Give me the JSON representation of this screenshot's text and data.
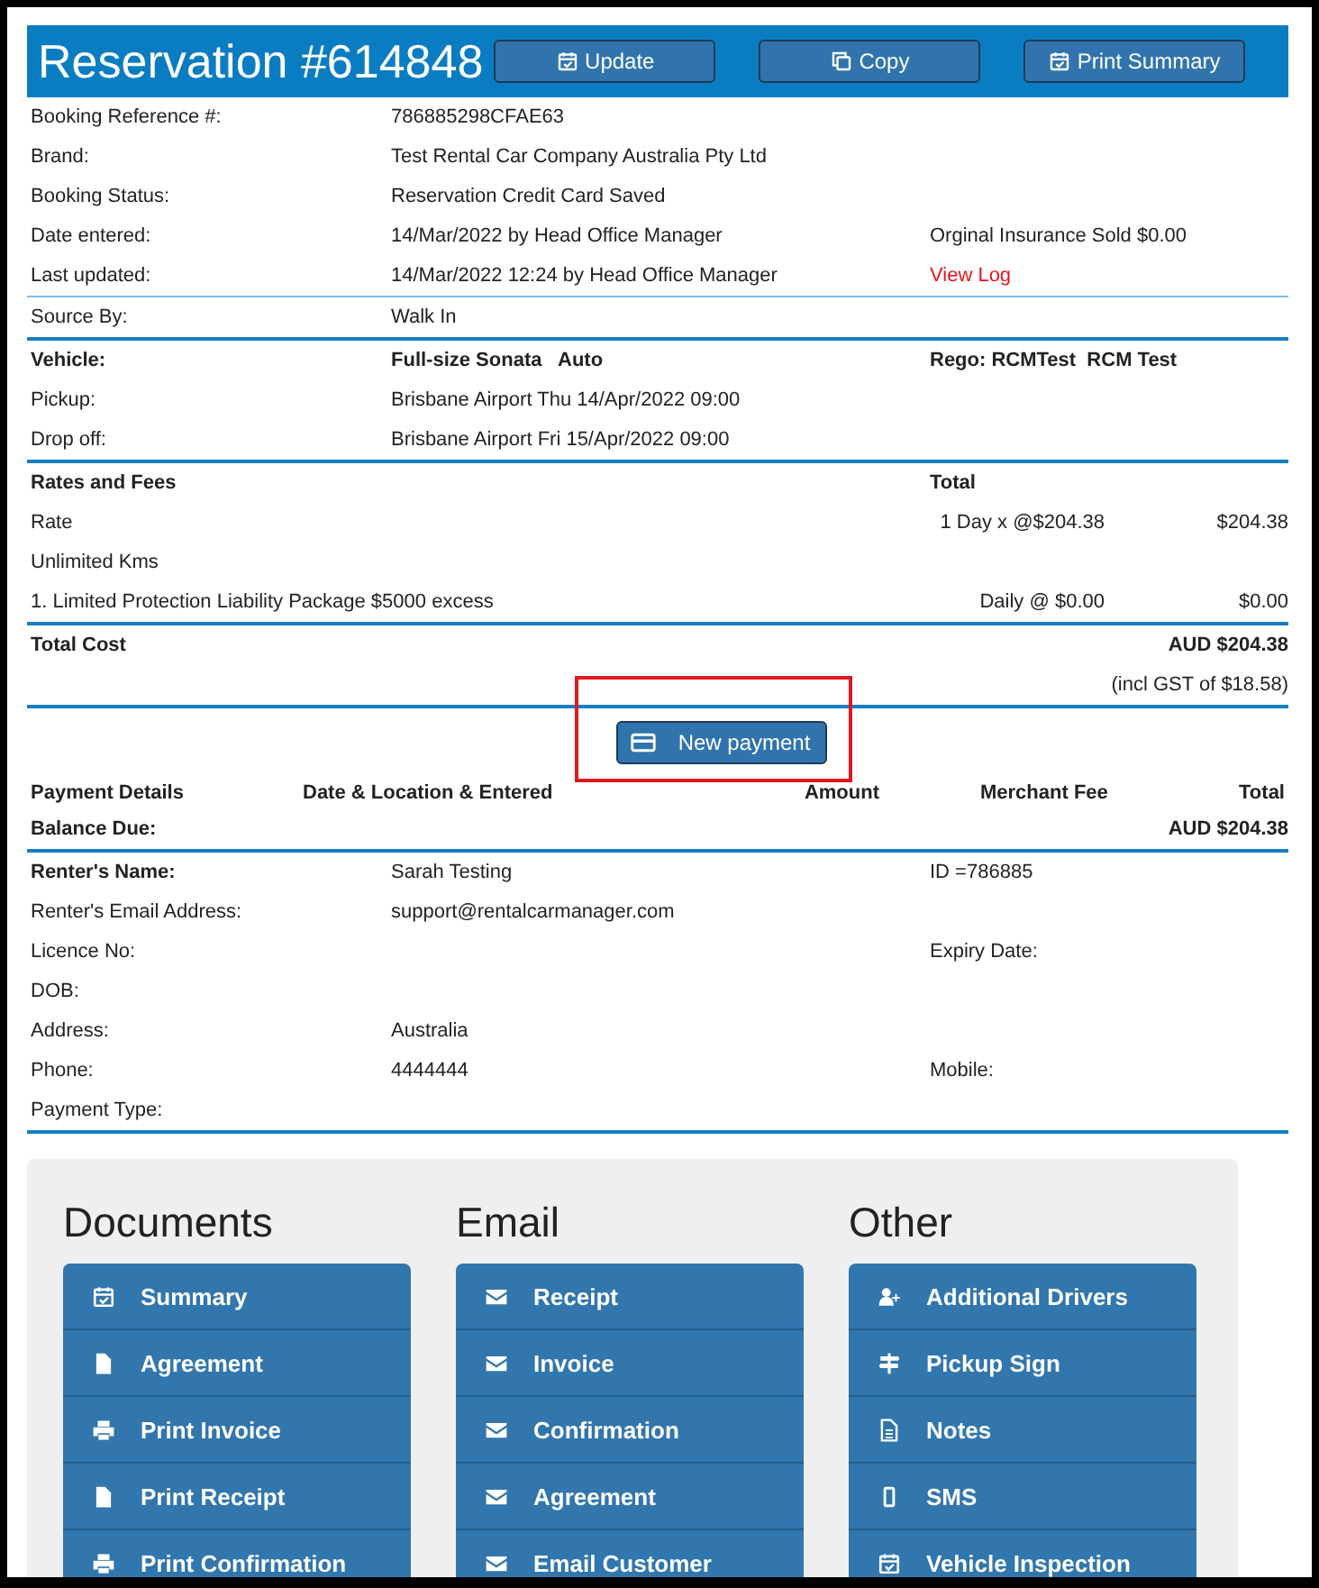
{
  "header": {
    "title": "Reservation #614848",
    "buttons": [
      {
        "label": "Update",
        "kind": "calendar"
      },
      {
        "label": "Copy",
        "kind": "copy"
      },
      {
        "label": "Print Summary",
        "kind": "calendar"
      }
    ]
  },
  "sections": [
    {
      "rows": [
        {
          "kind": "field",
          "label": "Booking Reference #:",
          "value": "786885298CFAE63"
        },
        {
          "kind": "field",
          "label": "Brand:",
          "value": "Test Rental Car Company Australia Pty Ltd"
        },
        {
          "kind": "field",
          "label": "Booking Status:",
          "value": "Reservation Credit Card Saved"
        },
        {
          "kind": "field",
          "label": "Date entered:",
          "value": "14/Mar/2022 by Head Office Manager",
          "side": "Orginal Insurance Sold $0.00"
        },
        {
          "kind": "field",
          "label": "Last updated:",
          "value": "14/Mar/2022 12:24 by Head Office Manager",
          "link": "View Log"
        }
      ]
    },
    {
      "rows": [
        {
          "kind": "field",
          "label": "Source By:",
          "value": "Walk In"
        }
      ]
    },
    {
      "rows": [
        {
          "kind": "field",
          "label": "Vehicle:",
          "value": "Full-size Sonata   Auto",
          "side": "Rego: RCMTest  RCM Test",
          "bold": true
        },
        {
          "kind": "field",
          "label": "Pickup:",
          "value": "Brisbane Airport Thu 14/Apr/2022 09:00"
        },
        {
          "kind": "field",
          "label": "Drop off:",
          "value": "Brisbane Airport Fri 15/Apr/2022 09:00"
        }
      ]
    },
    {
      "rows": [
        {
          "kind": "field",
          "label": "Rates and Fees",
          "side": "Total",
          "bold": true
        },
        {
          "kind": "fee",
          "label": "Rate",
          "rate": "1 Day x @$204.38",
          "amount": "$204.38"
        },
        {
          "kind": "fee",
          "label": "Unlimited Kms"
        },
        {
          "kind": "fee",
          "label": "1. Limited Protection Liability Package $5000 excess",
          "rate": "Daily @ $0.00",
          "amount": "$0.00"
        }
      ]
    },
    {
      "rows": [
        {
          "kind": "total",
          "label": "Total Cost",
          "amount": "AUD $204.38",
          "bold": true
        },
        {
          "kind": "total",
          "amount": "(incl GST of $18.58)"
        }
      ]
    },
    {
      "rows": [
        {
          "kind": "button",
          "label": "New payment",
          "highlighted": true
        },
        {
          "kind": "columns",
          "columns": [
            "Payment Details",
            "Date & Location & Entered",
            "Amount",
            "Merchant Fee",
            "Total"
          ]
        },
        {
          "kind": "total",
          "label": "Balance Due:",
          "amount": "AUD $204.38",
          "bold": true
        }
      ]
    },
    {
      "rows": [
        {
          "kind": "field",
          "label": "Renter's Name:",
          "value": "Sarah Testing",
          "side": "ID =786885",
          "label_bold": true
        },
        {
          "kind": "field",
          "label": "Renter's Email Address:",
          "value": "support@rentalcarmanager.com"
        },
        {
          "kind": "field",
          "label": "Licence No:",
          "side": "Expiry Date:"
        },
        {
          "kind": "field",
          "label": "DOB:"
        },
        {
          "kind": "field",
          "label": "Address:",
          "value": "Australia"
        },
        {
          "kind": "field",
          "label": "Phone:",
          "value": "4444444",
          "side": "Mobile:"
        },
        {
          "kind": "field",
          "label": "Payment Type:"
        }
      ]
    }
  ],
  "panels": [
    {
      "title": "Documents",
      "items": [
        {
          "label": "Summary",
          "kind": "calendar"
        },
        {
          "label": "Agreement",
          "kind": "file"
        },
        {
          "label": "Print Invoice",
          "kind": "printer"
        },
        {
          "label": "Print Receipt",
          "kind": "file"
        },
        {
          "label": "Print Confirmation",
          "kind": "printer"
        }
      ]
    },
    {
      "title": "Email",
      "items": [
        {
          "label": "Receipt",
          "kind": "envelope"
        },
        {
          "label": "Invoice",
          "kind": "envelope"
        },
        {
          "label": "Confirmation",
          "kind": "envelope"
        },
        {
          "label": "Agreement",
          "kind": "envelope"
        },
        {
          "label": "Email Customer",
          "kind": "envelope"
        }
      ]
    },
    {
      "title": "Other",
      "items": [
        {
          "label": "Additional Drivers",
          "kind": "user"
        },
        {
          "label": "Pickup Sign",
          "kind": "signpost"
        },
        {
          "label": "Notes",
          "kind": "document"
        },
        {
          "label": "SMS",
          "kind": "phone"
        },
        {
          "label": "Vehicle Inspection",
          "kind": "calendar"
        }
      ]
    }
  ]
}
